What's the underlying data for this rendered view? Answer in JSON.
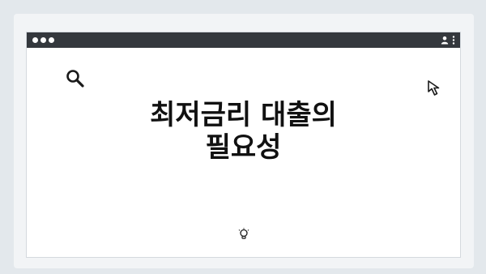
{
  "article": {
    "headline": "최저금리 대출의\n필요성"
  },
  "icons": {
    "search": "search-icon",
    "cursor": "cursor-arrow-icon",
    "lightbulb": "lightbulb-icon",
    "user": "user-icon",
    "menu": "more-vertical-icon"
  },
  "colors": {
    "background": "#e3e8ec",
    "titlebar": "#34383d",
    "text": "#111111"
  }
}
